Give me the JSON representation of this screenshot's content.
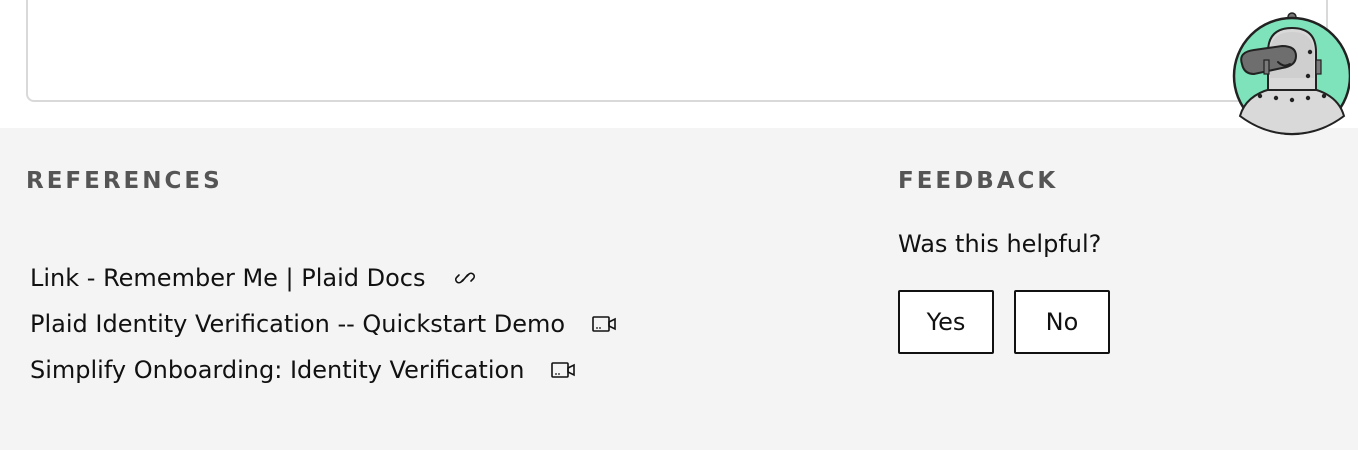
{
  "references": {
    "heading": "REFERENCES",
    "items": [
      {
        "label": "Link - Remember Me | Plaid Docs",
        "icon": "link-icon"
      },
      {
        "label": "Plaid Identity Verification -- Quickstart Demo",
        "icon": "video-icon"
      },
      {
        "label": "Simplify Onboarding: Identity Verification",
        "icon": "video-icon"
      }
    ]
  },
  "feedback": {
    "heading": "FEEDBACK",
    "question": "Was this helpful?",
    "yes_label": "Yes",
    "no_label": "No"
  },
  "assistant": {
    "avatar_icon": "robot-platypus-avatar"
  },
  "colors": {
    "footer_bg": "#f4f4f4",
    "heading_text": "#555555",
    "avatar_bg": "#7ee3bb"
  }
}
